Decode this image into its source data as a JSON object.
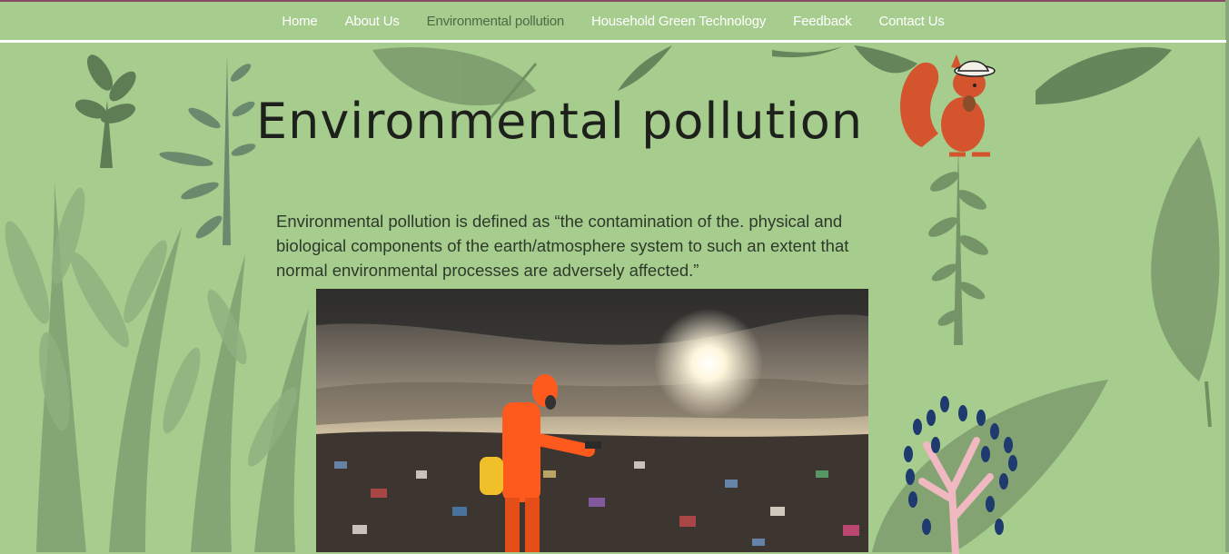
{
  "nav": {
    "items": [
      {
        "label": "Home",
        "active": false
      },
      {
        "label": "About Us",
        "active": false
      },
      {
        "label": "Environmental pollution",
        "active": true
      },
      {
        "label": "Household Green Technology",
        "active": false
      },
      {
        "label": "Feedback",
        "active": false
      },
      {
        "label": "Contact Us",
        "active": false
      }
    ]
  },
  "page": {
    "title": "Environmental pollution",
    "intro": "Environmental pollution is defined as “the contamination of the. physical and biological components of the earth/atmosphere system to such an extent that normal environmental processes are adversely affected.”"
  },
  "colors": {
    "background": "#a6cc8e",
    "nav_text": "#ffffff",
    "nav_active": "#4d6a45",
    "title": "#1e201c"
  },
  "icons": [
    "leaf-decoration",
    "fern-decoration",
    "squirrel-illustration",
    "pink-tree-illustration"
  ]
}
